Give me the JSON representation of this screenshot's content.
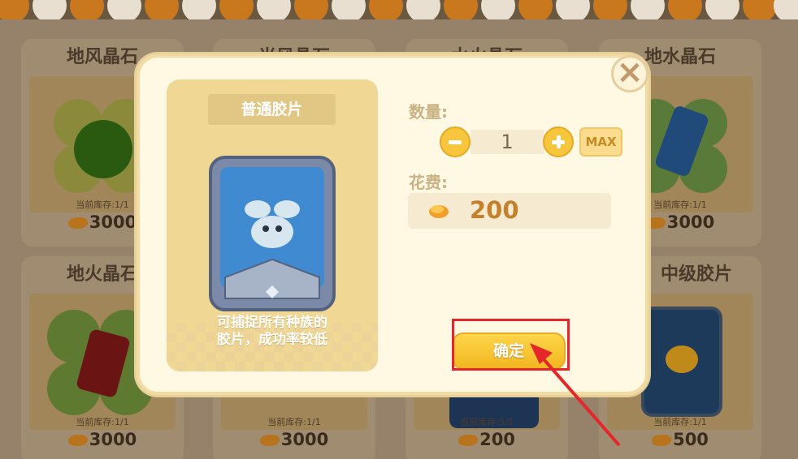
{
  "shop": {
    "cards": [
      {
        "title": "地风晶石",
        "stock": "当前库存:1/1",
        "price": "3000"
      },
      {
        "title": "光风晶石",
        "stock": "",
        "price": ""
      },
      {
        "title": "水火晶石",
        "stock": "",
        "price": ""
      },
      {
        "title": "地水晶石",
        "stock": "当前库存:1/1",
        "price": "3000"
      },
      {
        "title": "地火晶石",
        "stock": "当前库存:1/1",
        "price": "3000"
      },
      {
        "title": "",
        "stock": "当前库存:1/1",
        "price": "3000"
      },
      {
        "title": "",
        "stock": "当前库存:5/5",
        "price": "200"
      },
      {
        "title": "中级胶片",
        "stock": "当前库存:1/1",
        "price": "500"
      }
    ]
  },
  "modal": {
    "item_name": "普通胶片",
    "item_desc_line1": "可捕捉所有种族的",
    "item_desc_line2": "胶片，成功率较低",
    "qty_label": "数量:",
    "qty_value": "1",
    "max_label": "MAX",
    "cost_label": "花费:",
    "cost_value": "200",
    "confirm_label": "确定",
    "close_label": "×"
  },
  "colors": {
    "accent": "#f7c63c",
    "highlight": "#e5262a",
    "modal_bg": "#fff8e3"
  }
}
